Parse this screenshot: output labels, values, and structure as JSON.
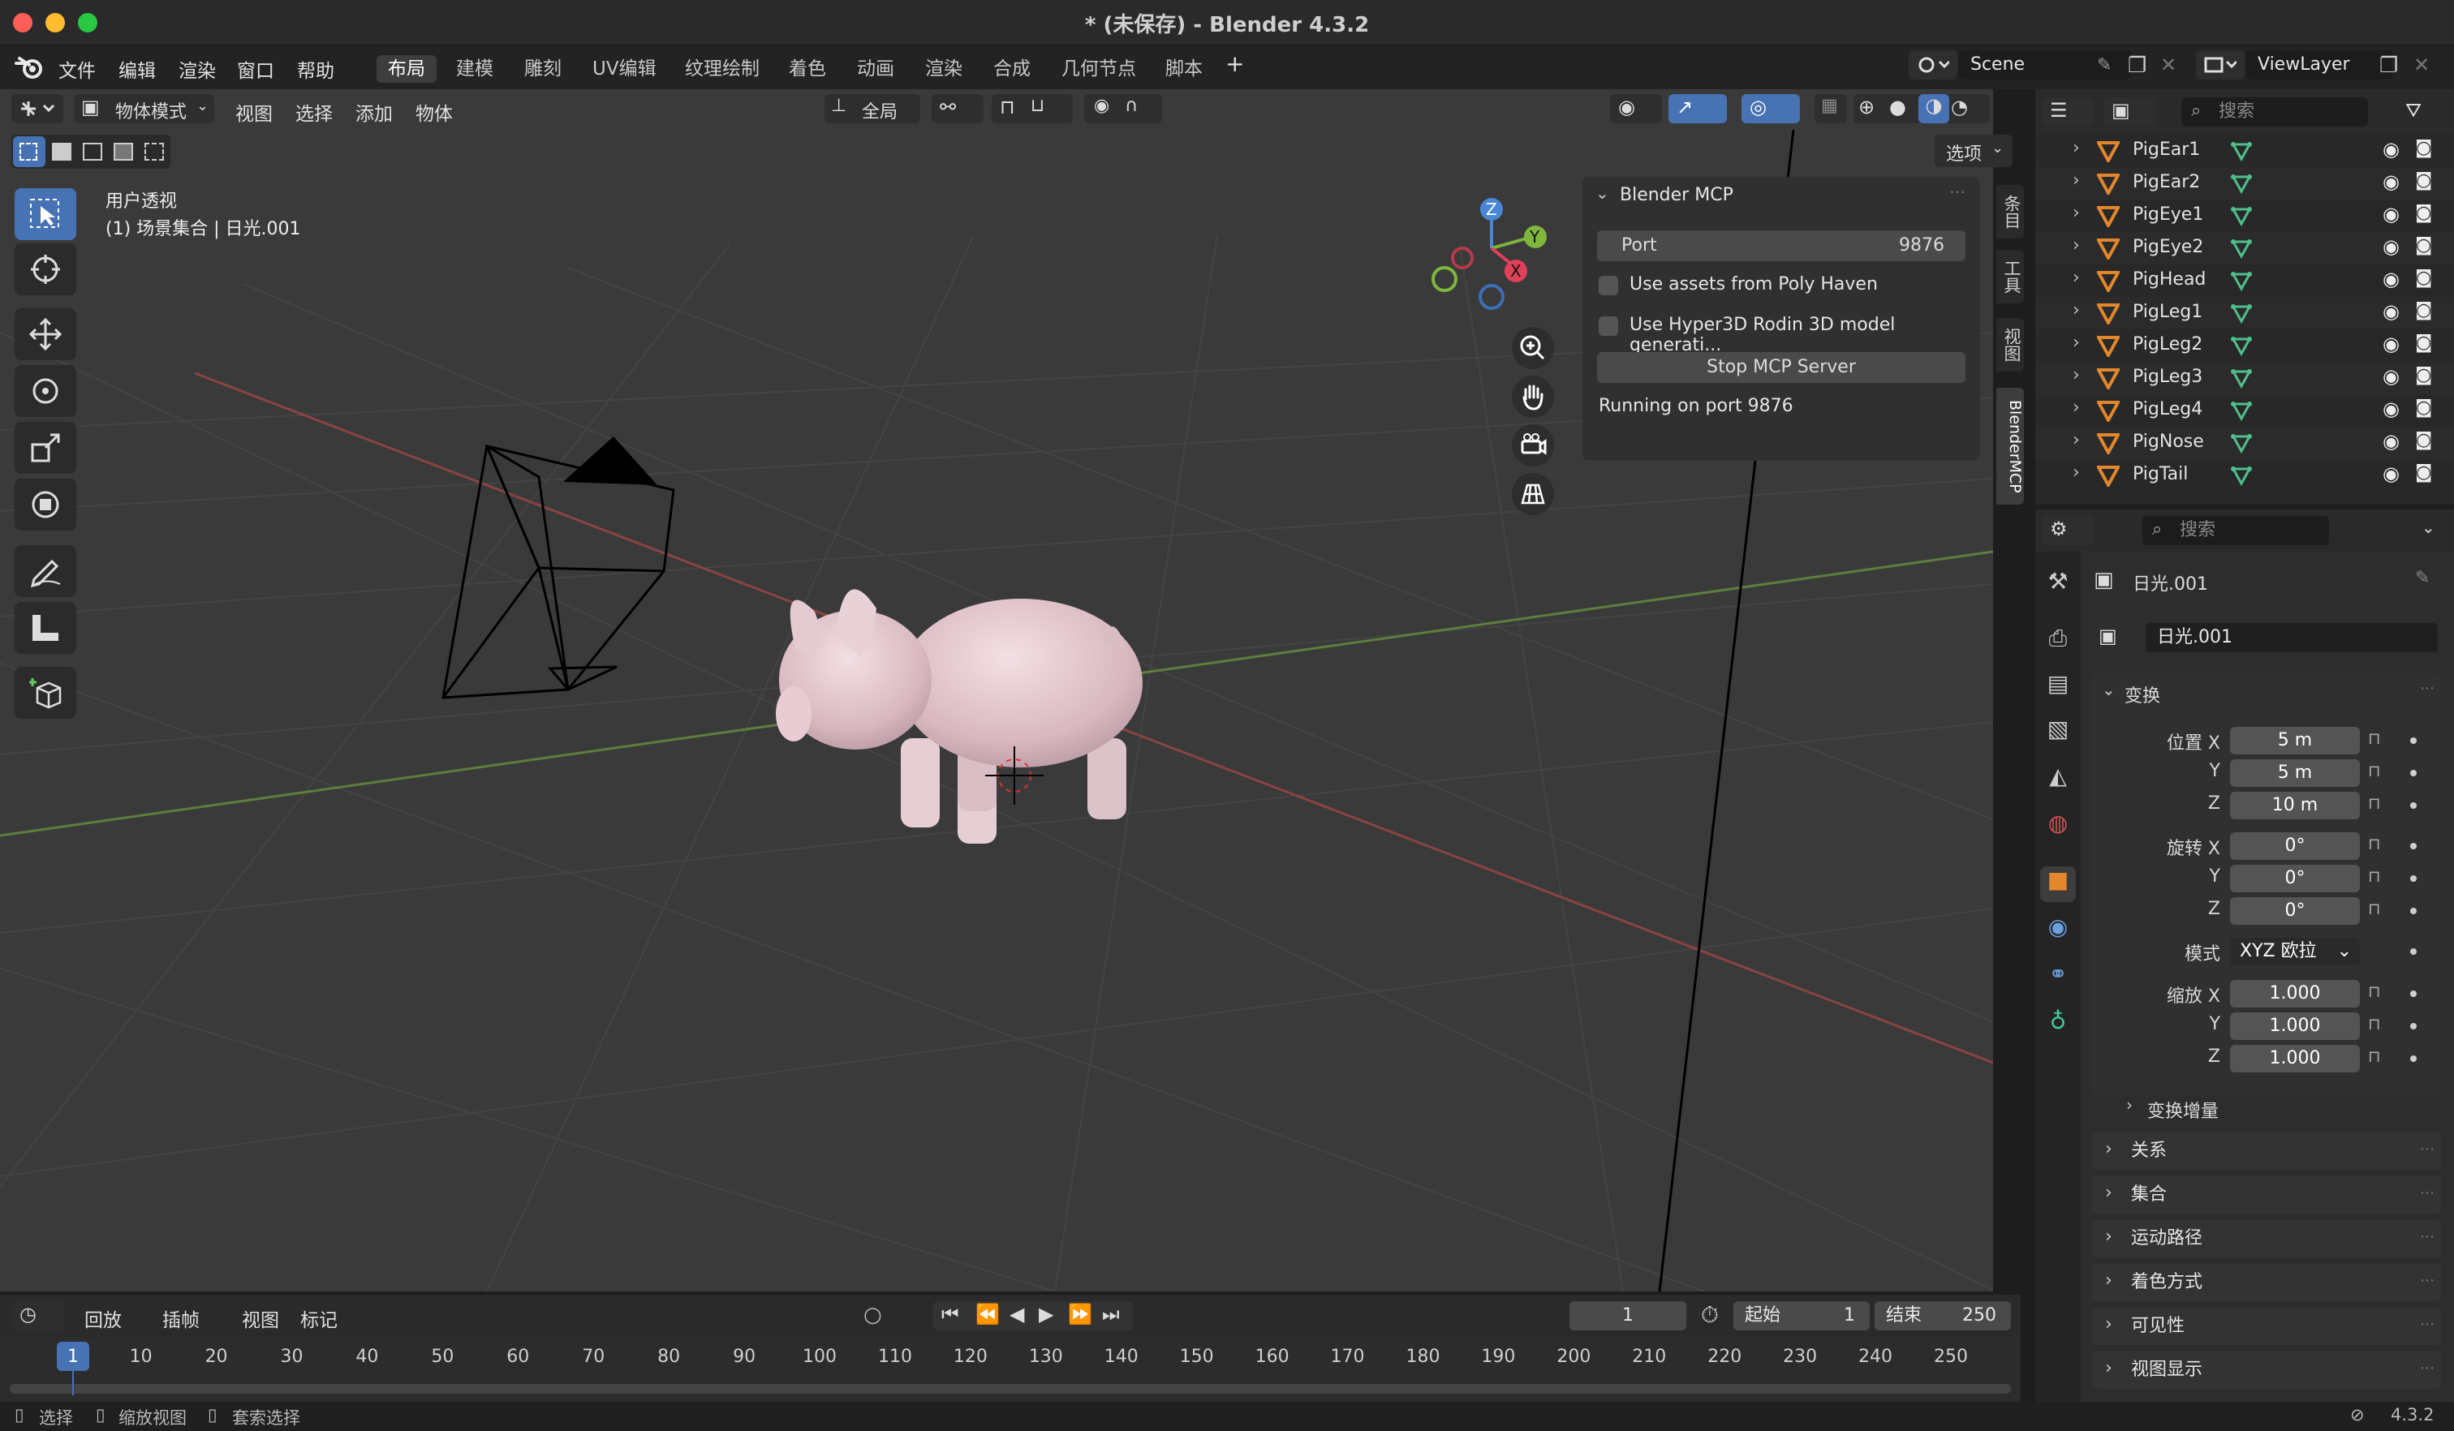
{
  "window": {
    "title": "* (未保存) - Blender 4.3.2"
  },
  "menu": [
    "文件",
    "编辑",
    "渲染",
    "窗口",
    "帮助"
  ],
  "workspaces": [
    {
      "label": "布局",
      "active": true
    },
    {
      "label": "建模"
    },
    {
      "label": "雕刻"
    },
    {
      "label": "UV编辑"
    },
    {
      "label": "纹理绘制"
    },
    {
      "label": "着色"
    },
    {
      "label": "动画"
    },
    {
      "label": "渲染"
    },
    {
      "label": "合成"
    },
    {
      "label": "几何节点"
    },
    {
      "label": "脚本"
    }
  ],
  "scene": {
    "name": "Scene",
    "viewlayer": "ViewLayer"
  },
  "viewport": {
    "mode": "物体模式",
    "menus": [
      "视图",
      "选择",
      "添加",
      "物体"
    ],
    "orientation": "全局",
    "options_label": "选项",
    "overlay_line1": "用户透视",
    "overlay_line2": "(1) 场景集合 | 日光.001",
    "gizmo": {
      "z": "Z",
      "y": "Y",
      "x": "X"
    }
  },
  "mcp_panel": {
    "title": "Blender MCP",
    "port_label": "Port",
    "port_value": "9876",
    "opt1": "Use assets from Poly Haven",
    "opt2": "Use Hyper3D Rodin 3D model generati...",
    "button": "Stop MCP Server",
    "status": "Running on port 9876"
  },
  "side_tabs": [
    "条目",
    "工具",
    "视图",
    "BlenderMCP"
  ],
  "outliner": {
    "search_placeholder": "搜索",
    "items": [
      "PigEar1",
      "PigEar2",
      "PigEye1",
      "PigEye2",
      "PigHead",
      "PigLeg1",
      "PigLeg2",
      "PigLeg3",
      "PigLeg4",
      "PigNose",
      "PigTail"
    ]
  },
  "properties": {
    "search_placeholder": "搜索",
    "object_name": "日光.001",
    "data_name": "日光.001",
    "transform_title": "变换",
    "location_label": "位置 X",
    "location": [
      "5 m",
      "5 m",
      "10 m"
    ],
    "rotation_label": "旋转 X",
    "rotation": [
      "0°",
      "0°",
      "0°"
    ],
    "mode_label": "模式",
    "mode_value": "XYZ 欧拉",
    "scale_label": "缩放 X",
    "scale": [
      "1.000",
      "1.000",
      "1.000"
    ],
    "axis_y": "Y",
    "axis_z": "Z",
    "delta": "变换增量",
    "sections": [
      "关系",
      "集合",
      "运动路径",
      "着色方式",
      "可见性",
      "视图显示"
    ]
  },
  "timeline": {
    "menus": [
      "回放",
      "插帧",
      "视图",
      "标记"
    ],
    "current_frame": "1",
    "start_label": "起始",
    "start": "1",
    "end_label": "结束",
    "end": "250",
    "ticks": [
      "1",
      "10",
      "20",
      "30",
      "40",
      "50",
      "60",
      "70",
      "80",
      "90",
      "100",
      "110",
      "120",
      "130",
      "140",
      "150",
      "160",
      "170",
      "180",
      "190",
      "200",
      "210",
      "220",
      "230",
      "240",
      "250"
    ]
  },
  "status": {
    "select": "选择",
    "zoom": "缩放视图",
    "lasso": "套索选择",
    "version": "4.3.2"
  },
  "colors": {
    "accent": "#4772b3",
    "x_axis": "#c24b4b",
    "y_axis": "#6b9a3a",
    "object_orange": "#e3872d"
  }
}
